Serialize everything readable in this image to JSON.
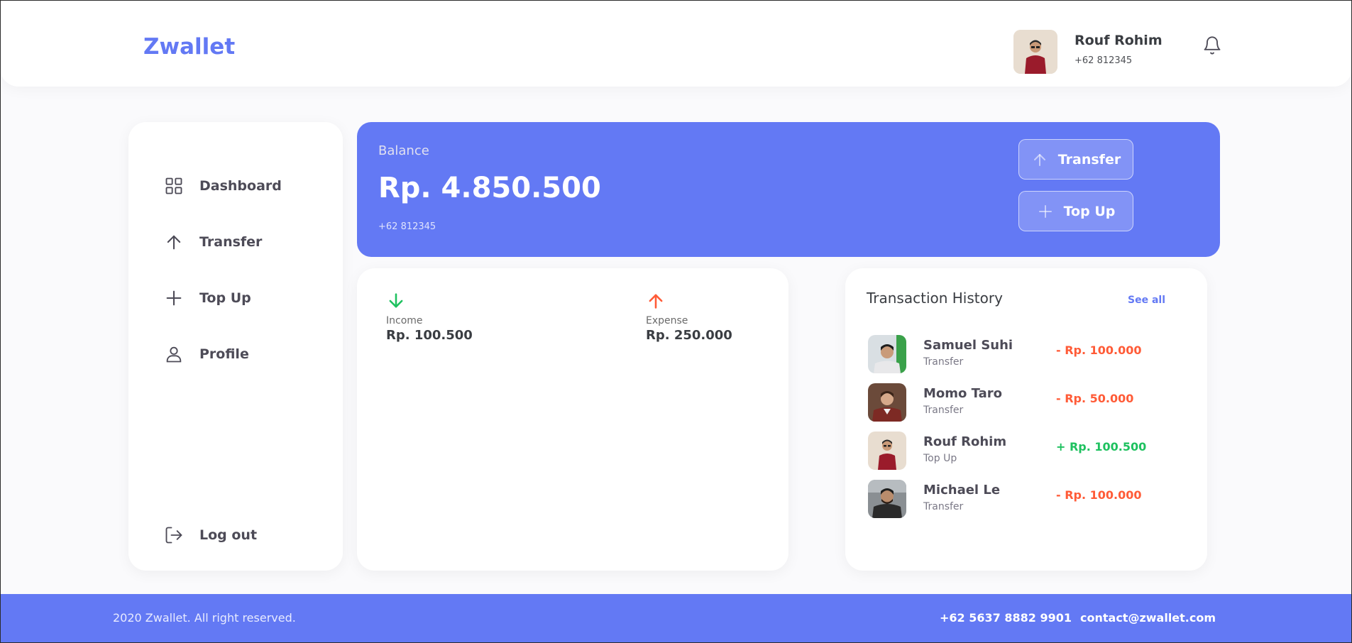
{
  "header": {
    "brand": "Zwallet",
    "user": {
      "name": "Rouf Rohim",
      "phone": "+62 812345"
    }
  },
  "sidebar": {
    "items": [
      {
        "label": "Dashboard",
        "icon": "grid-icon"
      },
      {
        "label": "Transfer",
        "icon": "arrow-up-icon"
      },
      {
        "label": "Top Up",
        "icon": "plus-icon"
      },
      {
        "label": "Profile",
        "icon": "user-icon"
      }
    ],
    "logout": {
      "label": "Log out",
      "icon": "logout-icon"
    }
  },
  "balance": {
    "label": "Balance",
    "amount": "Rp. 4.850.500",
    "phone": "+62 812345",
    "transfer_label": "Transfer",
    "topup_label": "Top Up"
  },
  "stats": {
    "income": {
      "label": "Income",
      "value": "Rp. 100.500",
      "color": "#1ec15f"
    },
    "expense": {
      "label": "Expense",
      "value": "Rp. 250.000",
      "color": "#ff5b37"
    }
  },
  "history": {
    "title": "Transaction History",
    "see_all": "See all",
    "items": [
      {
        "name": "Samuel Suhi",
        "type": "Transfer",
        "amount": "- Rp. 100.000",
        "color": "#ff5b37"
      },
      {
        "name": "Momo Taro",
        "type": "Transfer",
        "amount": "- Rp. 50.000",
        "color": "#ff5b37"
      },
      {
        "name": "Rouf Rohim",
        "type": "Top Up",
        "amount": "+ Rp. 100.500",
        "color": "#1ec15f"
      },
      {
        "name": "Michael Le",
        "type": "Transfer",
        "amount": "- Rp. 100.000",
        "color": "#ff5b37"
      }
    ]
  },
  "footer": {
    "copyright": "2020 Zwallet. All right reserved.",
    "phone": "+62 5637 8882 9901",
    "email": "contact@zwallet.com"
  },
  "colors": {
    "primary": "#6379f4",
    "income": "#1ec15f",
    "expense": "#ff5b37"
  }
}
